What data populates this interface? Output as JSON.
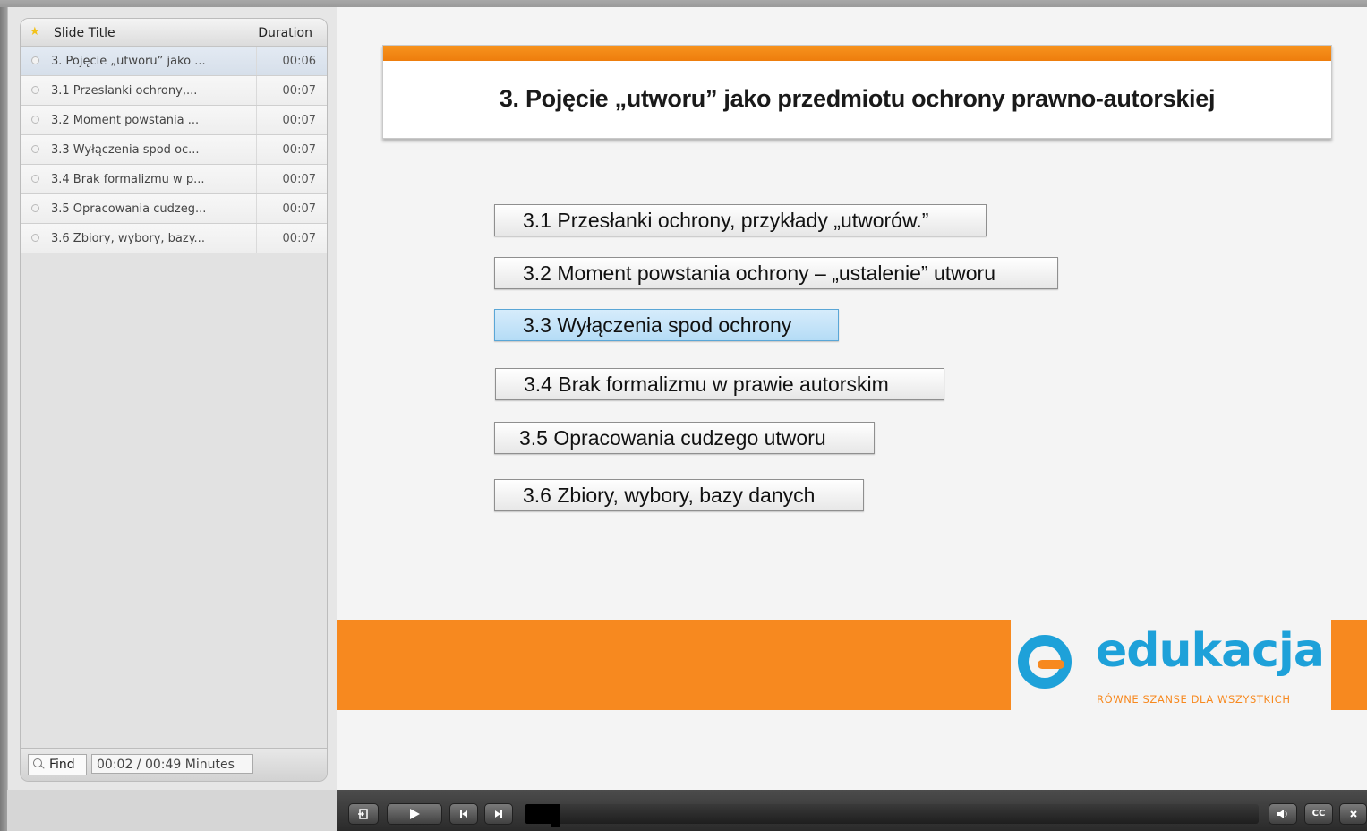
{
  "outline": {
    "header_title": "Slide Title",
    "header_duration": "Duration",
    "items": [
      {
        "title": "3. Pojęcie „utworu” jako ...",
        "duration": "00:06",
        "active": true
      },
      {
        "title": "3.1  Przesłanki ochrony,...",
        "duration": "00:07",
        "active": false
      },
      {
        "title": "3.2  Moment powstania ...",
        "duration": "00:07",
        "active": false
      },
      {
        "title": "3.3 Wyłączenia spod oc...",
        "duration": "00:07",
        "active": false
      },
      {
        "title": "3.4 Brak formalizmu w p...",
        "duration": "00:07",
        "active": false
      },
      {
        "title": "3.5 Opracowania cudzeg...",
        "duration": "00:07",
        "active": false
      },
      {
        "title": "3.6 Zbiory, wybory, bazy...",
        "duration": "00:07",
        "active": false
      }
    ],
    "find_label": "Find",
    "time_readout": "00:02 / 00:49 Minutes"
  },
  "slide": {
    "title": "3. Pojęcie „utworu” jako przedmiotu ochrony prawno-autorskiej",
    "buttons": [
      {
        "label": "3.1 Przesłanki ochrony, przykłady „utworów.”",
        "hover": false
      },
      {
        "label": "3.2 Moment powstania ochrony – „ustalenie” utworu",
        "hover": false
      },
      {
        "label": "3.3 Wyłączenia spod ochrony",
        "hover": true
      },
      {
        "label": "3.4 Brak formalizmu w prawie autorskim",
        "hover": false
      },
      {
        "label": "3.5 Opracowania cudzego utworu",
        "hover": false
      },
      {
        "label": "3.6 Zbiory, wybory, bazy danych",
        "hover": false
      }
    ],
    "logo": {
      "word": "edukacja",
      "tagline": "RÓWNE SZANSE DLA WSZYSTKICH",
      "colors": {
        "blue": "#1ea1d9",
        "orange": "#f7891f"
      }
    }
  },
  "player": {
    "progress": 0.04,
    "buttons": {
      "exit": "exit-icon",
      "play": "play-icon",
      "prev": "previous-icon",
      "next": "next-icon",
      "volume": "volume-icon",
      "cc": "CC",
      "close": "close-icon"
    }
  }
}
